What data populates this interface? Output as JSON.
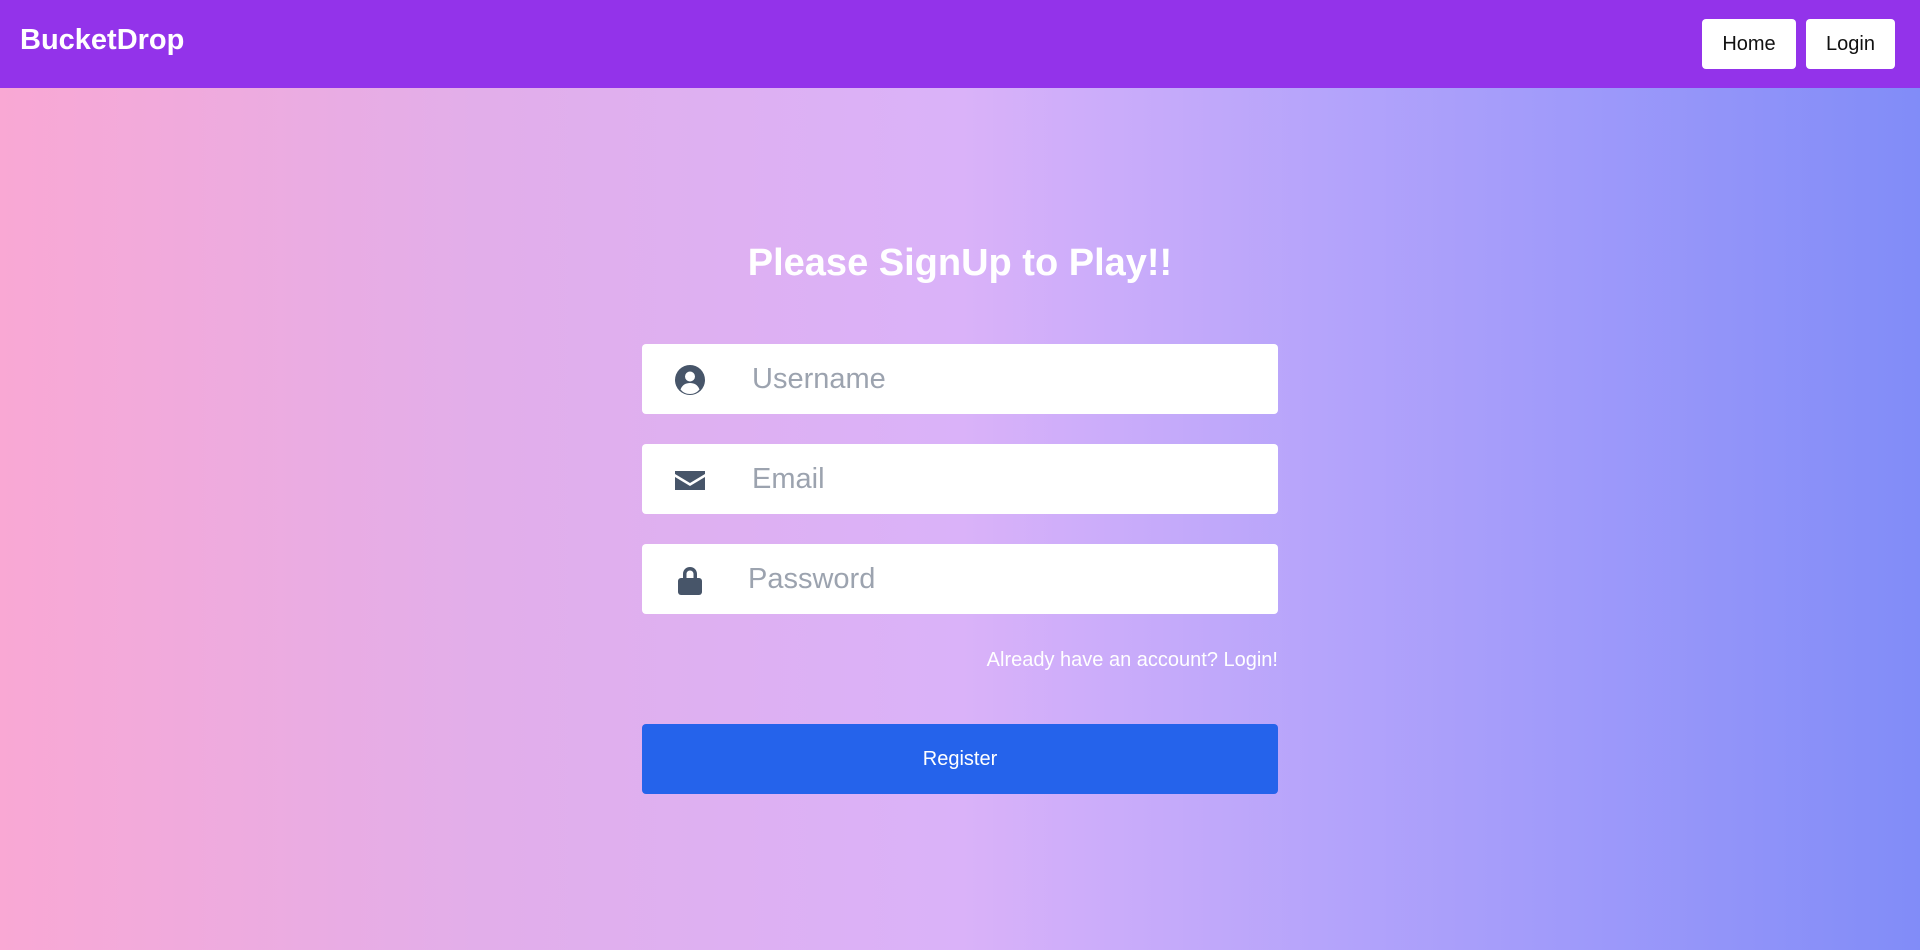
{
  "navbar": {
    "brand": "BucketDrop",
    "home_label": "Home",
    "login_label": "Login",
    "background_color": "#9333ea"
  },
  "form": {
    "title": "Please SignUp to Play!!",
    "username": {
      "placeholder": "Username",
      "value": "",
      "icon": "user-circle-icon"
    },
    "email": {
      "placeholder": "Email",
      "value": "",
      "icon": "envelope-icon"
    },
    "password": {
      "placeholder": "Password",
      "value": "",
      "icon": "lock-icon"
    },
    "login_link": "Already have an account? Login!",
    "register_label": "Register",
    "register_color": "#2563eb"
  },
  "colors": {
    "gradient_start": "#f9a8d4",
    "gradient_end": "#818cf8",
    "icon_color": "#475569"
  }
}
